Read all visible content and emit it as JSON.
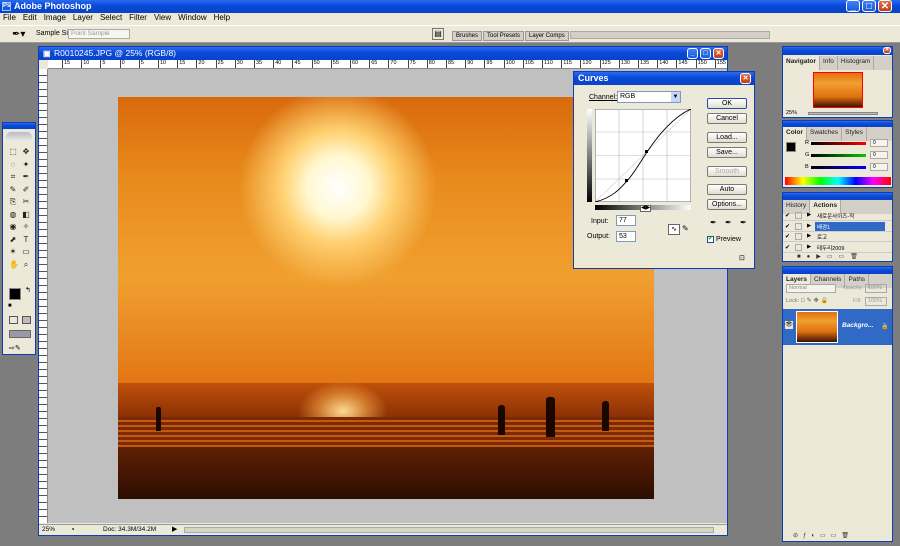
{
  "app": {
    "title": "Adobe Photoshop"
  },
  "menu": [
    "File",
    "Edit",
    "Image",
    "Layer",
    "Select",
    "Filter",
    "View",
    "Window",
    "Help"
  ],
  "options": {
    "sample_label": "Sample Size:",
    "sample_value": "Point Sample"
  },
  "palette_well": [
    "Brushes",
    "Tool Presets",
    "Layer Comps"
  ],
  "doc": {
    "title": "R0010245.JPG @ 25% (RGB/8)",
    "zoom": "25%",
    "status": "Doc: 34.3M/34.2M"
  },
  "ruler_labels": [
    "15",
    "10",
    "5",
    "0",
    "5",
    "10",
    "15",
    "20",
    "25",
    "30",
    "35",
    "40",
    "45",
    "50",
    "55",
    "60",
    "65",
    "70",
    "75",
    "80",
    "85",
    "90",
    "95",
    "100",
    "105",
    "110",
    "115",
    "120",
    "125",
    "130",
    "135",
    "140",
    "145",
    "150",
    "155"
  ],
  "curves": {
    "title": "Curves",
    "channel_label": "Channel:",
    "channel": "RGB",
    "input_label": "Input:",
    "input": "77",
    "output_label": "Output:",
    "output": "53",
    "ok": "OK",
    "cancel": "Cancel",
    "load": "Load...",
    "save": "Save...",
    "smooth": "Smooth",
    "auto": "Auto",
    "options": "Options...",
    "preview": "Preview"
  },
  "navigator": {
    "tabs": [
      "Navigator",
      "Info",
      "Histogram"
    ],
    "zoom": "25%"
  },
  "color": {
    "tabs": [
      "Color",
      "Swatches",
      "Styles"
    ],
    "r": "R",
    "g": "G",
    "b": "B",
    "rv": "0",
    "gv": "0",
    "bv": "0"
  },
  "history": {
    "tabs": [
      "History",
      "Actions"
    ],
    "items": [
      "새로운사이즈-작",
      "배경1",
      "로고",
      "테두리2009"
    ]
  },
  "layers": {
    "tabs": [
      "Layers",
      "Channels",
      "Paths"
    ],
    "mode": "Normal",
    "opacity_label": "Opacity:",
    "opacity": "100%",
    "lock_label": "Lock:",
    "fill_label": "Fill:",
    "fill": "100%",
    "layer_name": "Backgro..."
  },
  "colors": {
    "titlebar": "#0a48d6",
    "panel": "#ece9d8",
    "workspace": "#7d7d7d"
  }
}
